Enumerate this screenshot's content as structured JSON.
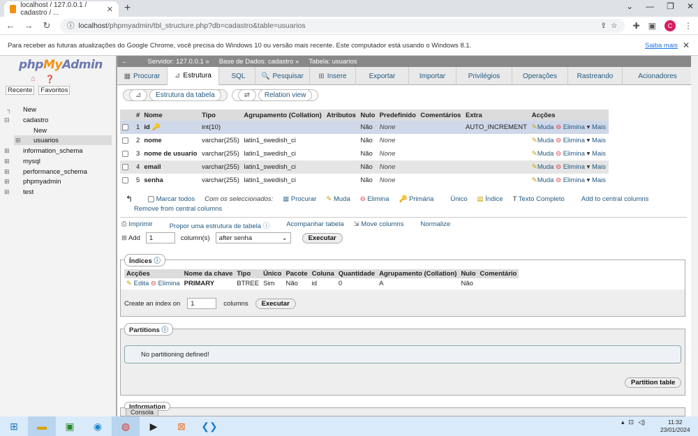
{
  "browser": {
    "tab_title": "localhost / 127.0.0.1 / cadastro / ...",
    "url_host": "localhost",
    "url_path": "/phpmyadmin/tbl_structure.php?db=cadastro&table=usuarios",
    "avatar_letter": "C",
    "infobar_text": "Para receber as futuras atualizações do Google Chrome, você precisa do Windows 10 ou versão mais recente. Este computador está usando o Windows 8.1.",
    "infobar_link": "Saiba mais"
  },
  "sidebar": {
    "logo_php": "php",
    "logo_my": "My",
    "logo_admin": "Admin",
    "tab_recent": "Recente",
    "tab_favorites": "Favoritos",
    "tree": [
      {
        "label": "New"
      },
      {
        "label": "cadastro"
      },
      {
        "label": "New"
      },
      {
        "label": "usuarios"
      },
      {
        "label": "information_schema"
      },
      {
        "label": "mysql"
      },
      {
        "label": "performance_schema"
      },
      {
        "label": "phpmyadmin"
      },
      {
        "label": "test"
      }
    ]
  },
  "breadcrumb": {
    "server": "Servidor: 127.0.0.1 »",
    "database": "Base de Dados: cadastro »",
    "table": "Tabela: usuarios"
  },
  "menu": [
    "Procurar",
    "Estrutura",
    "SQL",
    "Pesquisar",
    "Insere",
    "Exportar",
    "Importar",
    "Privilégios",
    "Operações",
    "Rastreando",
    "Acionadores"
  ],
  "subtabs": {
    "structure": "Estrutura da tabela",
    "relation": "Relation view"
  },
  "structure": {
    "headers": [
      "#",
      "Nome",
      "Tipo",
      "Agrupamento (Collation)",
      "Atributos",
      "Nulo",
      "Predefinido",
      "Comentários",
      "Extra",
      "Acções"
    ],
    "rows": [
      {
        "num": "1",
        "name": "id",
        "type": "int(10)",
        "collation": "",
        "null": "Não",
        "default": "None",
        "extra": "AUTO_INCREMENT"
      },
      {
        "num": "2",
        "name": "nome",
        "type": "varchar(255)",
        "collation": "latin1_swedish_ci",
        "null": "Não",
        "default": "None",
        "extra": ""
      },
      {
        "num": "3",
        "name": "nome de usuario",
        "type": "varchar(255)",
        "collation": "latin1_swedish_ci",
        "null": "Não",
        "default": "None",
        "extra": ""
      },
      {
        "num": "4",
        "name": "email",
        "type": "varchar(255)",
        "collation": "latin1_swedish_ci",
        "null": "Não",
        "default": "None",
        "extra": ""
      },
      {
        "num": "5",
        "name": "senha",
        "type": "varchar(255)",
        "collation": "latin1_swedish_ci",
        "null": "Não",
        "default": "None",
        "extra": ""
      }
    ],
    "action_change": "Muda",
    "action_drop": "Elimina",
    "action_more": "Mais"
  },
  "bulk": {
    "check_all": "Marcar todos",
    "with_selected": "Com os seleccionados:",
    "browse": "Procurar",
    "change": "Muda",
    "drop": "Elimina",
    "primary": "Primária",
    "unique": "Único",
    "index": "Índice",
    "fulltext": "Texto Completo",
    "central": "Add to central columns",
    "remove_central": "Remove from central columns"
  },
  "tools": {
    "print": "Imprimir",
    "propose": "Propor uma estrutura de tabela",
    "track": "Acompanhar tabela",
    "move": "Move columns",
    "normalize": "Normalize"
  },
  "addcol": {
    "add": "Add",
    "count": "1",
    "columns": "column(s)",
    "position": "after senha",
    "go": "Executar"
  },
  "indexes": {
    "legend": "Índices",
    "headers": [
      "Acções",
      "Nome da chave",
      "Tipo",
      "Único",
      "Pacote",
      "Coluna",
      "Quantidade",
      "Agrupamento (Collation)",
      "Nulo",
      "Comentário"
    ],
    "row": {
      "edit": "Edita",
      "drop": "Elimina",
      "key": "PRIMARY",
      "type": "BTREE",
      "unique": "Sim",
      "packed": "Não",
      "column": "id",
      "cardinality": "0",
      "collation": "A",
      "null": "Não",
      "comment": ""
    },
    "create_label": "Create an index on",
    "create_count": "1",
    "create_columns": "columns",
    "create_go": "Executar"
  },
  "partitions": {
    "legend": "Partitions",
    "empty": "No partitioning defined!",
    "button": "Partition table"
  },
  "information_legend": "Information",
  "console": "Consola",
  "clock": {
    "time": "11:32",
    "date": "23/01/2024"
  }
}
